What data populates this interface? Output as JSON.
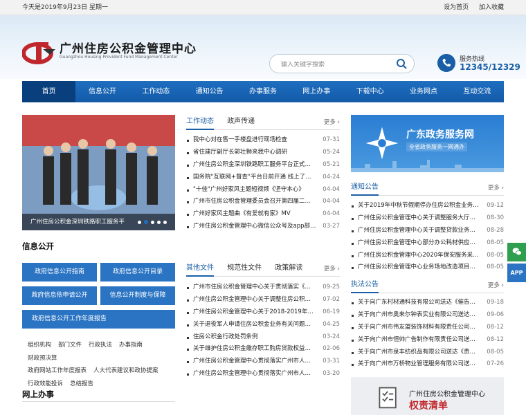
{
  "topbar": {
    "date": "今天是2019年9月23日 星期一",
    "set_home": "设为首页",
    "favorite": "加入收藏"
  },
  "header": {
    "logo_cn": "广州住房公积金管理中心",
    "logo_en": "Guangzhou Housing Provident Fund Management Center",
    "search_placeholder": "输入关键字搜索",
    "hotline_label": "服务热线",
    "hotline_number": "12345/12329"
  },
  "nav": [
    "首页",
    "信息公开",
    "工作动态",
    "通知公告",
    "办事服务",
    "网上办事",
    "下载中心",
    "业务网点",
    "互动交流"
  ],
  "slider": {
    "caption": "广州住房公积金深圳铁路职工服务平"
  },
  "work_news": {
    "tabs": [
      "工作动态",
      "政声传递"
    ],
    "more": "更多",
    "items": [
      {
        "title": "我中心对在售一手楼盘进行现场检查",
        "date": "07-31"
      },
      {
        "title": "省住建厅副厅长郭壮狮来我中心调研",
        "date": "05-24"
      },
      {
        "title": "广州住房公积金深圳铁路职工服务平台正式开通",
        "date": "05-21"
      },
      {
        "title": "国务院\"互联网+督查\"平台日前开通 线上了解情…",
        "date": "04-24"
      },
      {
        "title": "\"十佳\"广州好家风主题短视频《坚守本心》",
        "date": "04-04"
      },
      {
        "title": "广州市住房公积金管理委员会召开第四届二次…",
        "date": "04-04"
      },
      {
        "title": "广州好家风主题曲《有爱就有家》MV",
        "date": "04-04"
      },
      {
        "title": "广州住房公积金管理中心微信公众号及app部分…",
        "date": "03-27"
      }
    ]
  },
  "info_open": {
    "title": "信息公开",
    "buttons": [
      "政府信息公开指南",
      "政府信息公开目录",
      "政府信息依申请公开",
      "信息公开制度与保障",
      "政府信息公开工作年度报告"
    ],
    "links": [
      "组织机构",
      "部门文件",
      "行政执法",
      "办事指南",
      "财政预决算",
      "政府网站工作年度报表",
      "人大代表建议和政协提案",
      "行政效能投诉",
      "总结报告"
    ]
  },
  "other_docs": {
    "tabs": [
      "其他文件",
      "规范性文件",
      "政策解读"
    ],
    "more": "更多",
    "items": [
      {
        "title": "广州市住房公积金管理中心关于贯彻落实《关于…",
        "date": "09-25"
      },
      {
        "title": "广州住房公积金管理中心关于调整住房公积金…",
        "date": "07-02"
      },
      {
        "title": "广州住房公积金管理中心关于2018-2019年度住…",
        "date": "06-19"
      },
      {
        "title": "关于退役军人申请住房公积金业务有关问题的…",
        "date": "04-25"
      },
      {
        "title": "住房公积金行政处罚条例",
        "date": "03-24"
      },
      {
        "title": "关于维护住房公积金缴存职工购房贷款权益的…",
        "date": "02-06"
      },
      {
        "title": "广州住房公积金管理中心贯彻落实广州市人民…",
        "date": "03-31"
      },
      {
        "title": "广州住房公积金管理中心贯彻落实广州市人民…",
        "date": "03-20"
      }
    ]
  },
  "gov_service": {
    "title": "广东政务服务网",
    "subtitle": "全省政务服务一网通办"
  },
  "notices": {
    "title": "通知公告",
    "more": "更多",
    "items": [
      {
        "title": "关于2019年中秋节假期停办住房公积金业务的…",
        "date": "09-12"
      },
      {
        "title": "广州住房公积金管理中心关于调整服务大厅对…",
        "date": "08-30"
      },
      {
        "title": "广州住房公积金管理中心关于调整贷款业务流…",
        "date": "08-28"
      },
      {
        "title": "广州住房公积金管理中心部分办公耗材供应商…",
        "date": "08-05"
      },
      {
        "title": "广州住房公积金管理中心2020年保安服务采购…",
        "date": "08-05"
      },
      {
        "title": "广州住房公积金管理中心业务场地改造项目采…",
        "date": "08-05"
      }
    ]
  },
  "enforcement": {
    "title": "执法公告",
    "more": "更多",
    "items": [
      {
        "title": "关于向广东村材通科技有限公司送达《催告书…",
        "date": "09-18"
      },
      {
        "title": "关于向广州市奥来尔钟表实业有限公司送达《…",
        "date": "09-06"
      },
      {
        "title": "关于向广州市伟友盟装饰材料有限责任公司送…",
        "date": "08-12"
      },
      {
        "title": "关于向广州市恒帅广告制作有限责任公司送达…",
        "date": "08-12"
      },
      {
        "title": "关于向广州市泉丰纺织品有限公司送达《责令…",
        "date": "08-05"
      },
      {
        "title": "关于向广州市万桥物业管理服务有限公司送达…",
        "date": "07-26"
      }
    ]
  },
  "rights_list": {
    "line1": "广州住房公积金管理中心",
    "line2": "权责清单"
  },
  "online": {
    "title": "网上办事"
  },
  "side": {
    "wechat": "微信",
    "app": "APP"
  },
  "colors": {
    "primary": "#1a5fa6",
    "nav": "#135aa8",
    "accent_red": "#c0272d"
  }
}
